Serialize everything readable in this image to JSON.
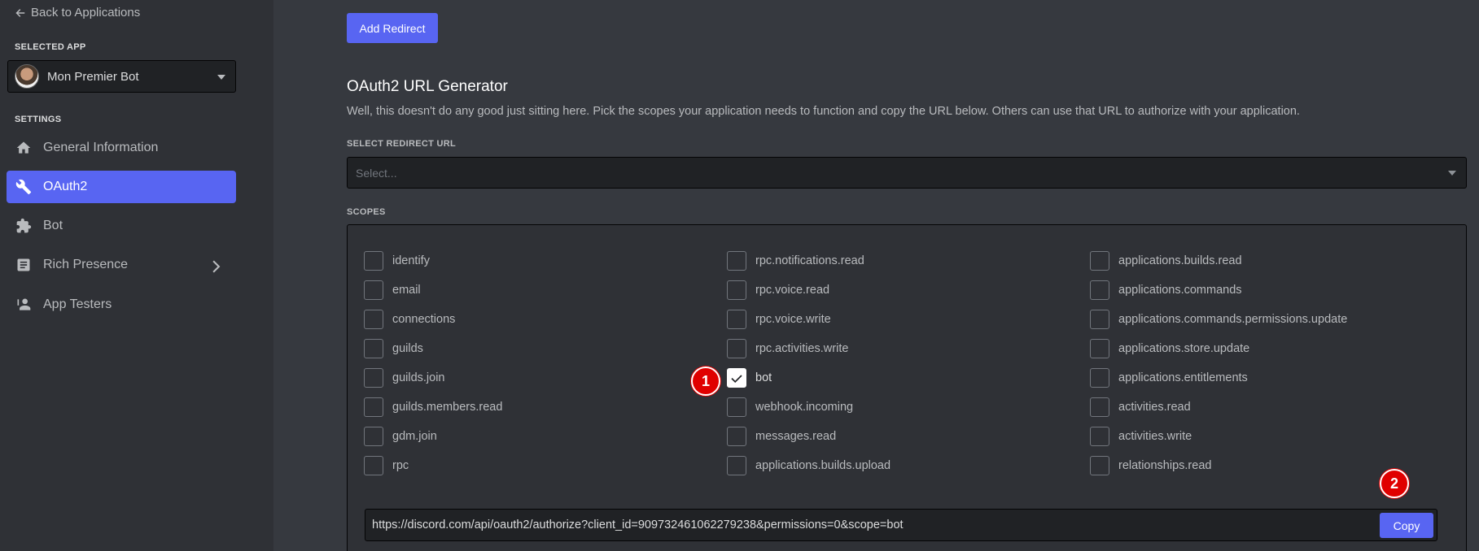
{
  "sidebar": {
    "back_label": "Back to Applications",
    "selected_app_heading": "SELECTED APP",
    "app_name": "Mon Premier Bot",
    "settings_heading": "SETTINGS",
    "items": [
      {
        "label": "General Information",
        "icon": "home-icon"
      },
      {
        "label": "OAuth2",
        "icon": "wrench-icon",
        "active": true
      },
      {
        "label": "Bot",
        "icon": "puzzle-icon"
      },
      {
        "label": "Rich Presence",
        "icon": "document-icon"
      },
      {
        "label": "App Testers",
        "icon": "person-icon"
      }
    ]
  },
  "main": {
    "add_redirect_label": "Add Redirect",
    "generator_title": "OAuth2 URL Generator",
    "generator_description": "Well, this doesn't do any good just sitting here. Pick the scopes your application needs to function and copy the URL below. Others can use that URL to authorize with your application.",
    "redirect_label": "SELECT REDIRECT URL",
    "redirect_placeholder": "Select...",
    "scopes_label": "SCOPES",
    "scopes": {
      "col1": [
        "identify",
        "email",
        "connections",
        "guilds",
        "guilds.join",
        "guilds.members.read",
        "gdm.join",
        "rpc"
      ],
      "col2": [
        "rpc.notifications.read",
        "rpc.voice.read",
        "rpc.voice.write",
        "rpc.activities.write",
        "bot",
        "webhook.incoming",
        "messages.read",
        "applications.builds.upload"
      ],
      "col3": [
        "applications.builds.read",
        "applications.commands",
        "applications.commands.permissions.update",
        "applications.store.update",
        "applications.entitlements",
        "activities.read",
        "activities.write",
        "relationships.read"
      ]
    },
    "checked_scopes": [
      "bot"
    ],
    "generated_url": "https://discord.com/api/oauth2/authorize?client_id=909732461062279238&permissions=0&scope=bot",
    "copy_label": "Copy"
  },
  "markers": [
    "1",
    "2"
  ],
  "colors": {
    "accent": "#5865f2",
    "background": "#36393f",
    "sidebar": "#2f3136",
    "marker": "#e00000"
  }
}
